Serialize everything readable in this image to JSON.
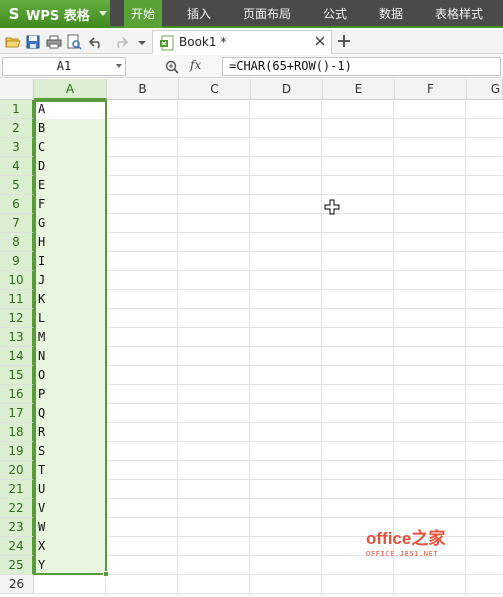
{
  "app": {
    "logo_glyph": "S",
    "name": "WPS 表格",
    "menu_tabs": [
      {
        "label": "开始",
        "active": true
      },
      {
        "label": "插入",
        "active": false
      },
      {
        "label": "页面布局",
        "active": false
      },
      {
        "label": "公式",
        "active": false
      },
      {
        "label": "数据",
        "active": false
      },
      {
        "label": "表格样式",
        "active": false
      }
    ],
    "accent_color": "#5aa136"
  },
  "toolbar": {
    "icons": [
      "open-folder-icon",
      "save-icon",
      "print-icon",
      "print-preview-icon",
      "undo-icon",
      "redo-icon",
      "customize-dropdown-icon"
    ],
    "document_tab": {
      "title": "Book1 *"
    },
    "new_tab_icon": "plus-icon"
  },
  "formula_bar": {
    "name_box": "A1",
    "fx_label": "fx",
    "formula": "=CHAR(65+ROW()-1)"
  },
  "grid": {
    "columns": [
      "A",
      "B",
      "C",
      "D",
      "E",
      "F",
      "G"
    ],
    "selected_column": "A",
    "rows": [
      "1",
      "2",
      "3",
      "4",
      "5",
      "6",
      "7",
      "8",
      "9",
      "10",
      "11",
      "12",
      "13",
      "14",
      "15",
      "16",
      "17",
      "18",
      "19",
      "20",
      "21",
      "22",
      "23",
      "24",
      "25",
      "26"
    ],
    "column_a_values": [
      "A",
      "B",
      "C",
      "D",
      "E",
      "F",
      "G",
      "H",
      "I",
      "J",
      "K",
      "L",
      "M",
      "N",
      "O",
      "P",
      "Q",
      "R",
      "S",
      "T",
      "U",
      "V",
      "W",
      "X",
      "Y"
    ],
    "selection_range": "A1:A25"
  },
  "watermark": {
    "logo": "office之家",
    "url": "OFFICE.JB51.NET"
  }
}
